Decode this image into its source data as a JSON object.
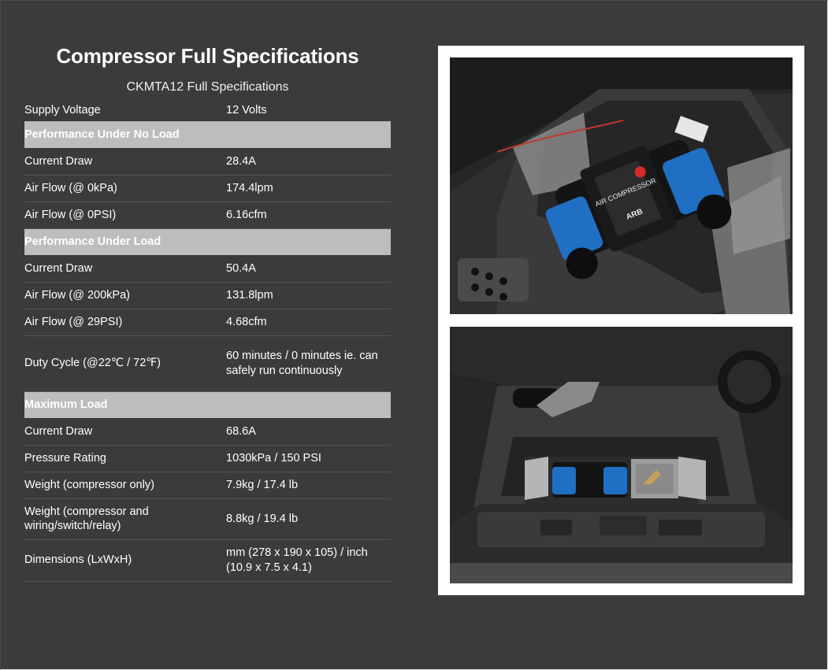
{
  "title": "Compressor Full Specifications",
  "subtitle": "CKMTA12 Full Specifications",
  "rows": [
    {
      "type": "row",
      "label": "Supply Voltage",
      "value": "12 Volts"
    },
    {
      "type": "section",
      "label": "Performance Under No Load"
    },
    {
      "type": "row",
      "label": "Current Draw",
      "value": "28.4A"
    },
    {
      "type": "row",
      "label": "Air Flow (@ 0kPa)",
      "value": "174.4lpm"
    },
    {
      "type": "row",
      "label": "Air Flow (@ 0PSI)",
      "value": "6.16cfm"
    },
    {
      "type": "section",
      "label": "Performance Under Load"
    },
    {
      "type": "row",
      "label": "Current Draw",
      "value": "50.4A"
    },
    {
      "type": "row",
      "label": "Air Flow (@ 200kPa)",
      "value": "131.8lpm"
    },
    {
      "type": "row",
      "label": "Air Flow (@ 29PSI)",
      "value": "4.68cfm"
    },
    {
      "type": "row",
      "label": "Duty Cycle (@22℃ / 72℉)",
      "value": "60 minutes / 0 minutes ie. can safely run continuously"
    },
    {
      "type": "section",
      "label": "Maximum Load"
    },
    {
      "type": "row",
      "label": "Current Draw",
      "value": "68.6A"
    },
    {
      "type": "row",
      "label": "Pressure Rating",
      "value": "1030kPa / 150 PSI"
    },
    {
      "type": "row",
      "label": "Weight (compressor only)",
      "value": "7.9kg / 17.4 lb"
    },
    {
      "type": "row",
      "label": "Weight (compressor and wiring/switch/relay)",
      "value": "8.8kg / 19.4 lb"
    },
    {
      "type": "row",
      "label": "Dimensions (LxWxH)",
      "value": "mm (278 x 190 x 105) / inch (10.9 x 7.5 x 4.1)"
    }
  ],
  "photos": {
    "top_compressor_brand": "ARB",
    "top_compressor_label": "AIR COMPRESSOR"
  },
  "colors": {
    "background": "#3b3b3b",
    "section_band": "#bdbdbd",
    "compressor_blue": "#1f6fc4",
    "card": "#ffffff"
  }
}
